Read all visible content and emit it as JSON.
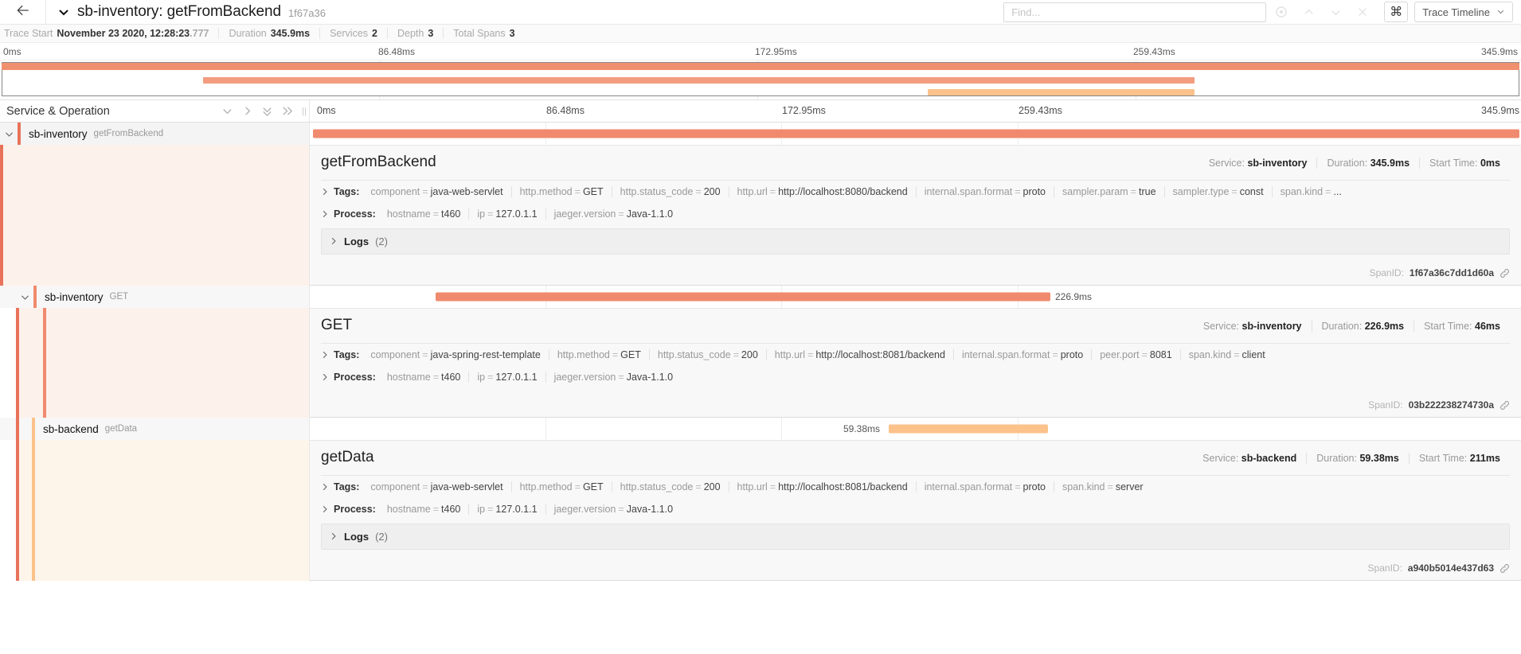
{
  "header": {
    "back_icon": "arrow-left-icon",
    "caret_icon": "chevron-down-icon",
    "trace_title": "sb-inventory: getFromBackend",
    "trace_id": "1f67a36",
    "find_placeholder": "Find...",
    "find_value": "",
    "nav_icons": [
      "crosshair-icon",
      "chevron-up-icon",
      "chevron-down-icon",
      "close-icon"
    ],
    "kbd_label": "⌘",
    "view_label": "Trace Timeline"
  },
  "meta": {
    "trace_start_label": "Trace Start",
    "trace_start_value": "November 23 2020, 12:28:23",
    "trace_start_frac": ".777",
    "duration_label": "Duration",
    "duration_value": "345.9ms",
    "services_label": "Services",
    "services_value": "2",
    "depth_label": "Depth",
    "depth_value": "3",
    "total_spans_label": "Total Spans",
    "total_spans_value": "3"
  },
  "minimap": {
    "ticks": [
      "0ms",
      "86.48ms",
      "172.95ms",
      "259.43ms",
      "345.9ms"
    ]
  },
  "columns": {
    "service_operation": "Service & Operation",
    "actions": [
      "chevron-down-icon",
      "chevron-right-icon",
      "double-chevron-down-icon",
      "double-chevron-right-icon"
    ],
    "grip_icon": "column-resize-grip-icon",
    "ticks": [
      "0ms",
      "86.48ms",
      "172.95ms",
      "259.43ms",
      "345.9ms"
    ]
  },
  "colors": {
    "accent_dark": "#e8735a",
    "accent_bar": "#f08a6e",
    "accent_light": "#fbc28b",
    "row_tint": "#fdf1ec",
    "row_tint_light": "#fdf5ea"
  },
  "spans": [
    {
      "service": "sb-inventory",
      "operation": "getFromBackend",
      "depth": 0,
      "expander_icon": "chevron-down-icon",
      "bar_label": "",
      "detail": {
        "operation": "getFromBackend",
        "service_label": "Service:",
        "service_value": "sb-inventory",
        "duration_label": "Duration:",
        "duration_value": "345.9ms",
        "start_label": "Start Time:",
        "start_value": "0ms",
        "tags_label": "Tags:",
        "tags": [
          {
            "k": "component",
            "v": "java-web-servlet"
          },
          {
            "k": "http.method",
            "v": "GET"
          },
          {
            "k": "http.status_code",
            "v": "200"
          },
          {
            "k": "http.url",
            "v": "http://localhost:8080/backend"
          },
          {
            "k": "internal.span.format",
            "v": "proto"
          },
          {
            "k": "sampler.param",
            "v": "true"
          },
          {
            "k": "sampler.type",
            "v": "const"
          },
          {
            "k": "span.kind",
            "v": "..."
          }
        ],
        "process_label": "Process:",
        "process": [
          {
            "k": "hostname",
            "v": "t460"
          },
          {
            "k": "ip",
            "v": "127.0.1.1"
          },
          {
            "k": "jaeger.version",
            "v": "Java-1.1.0"
          }
        ],
        "logs_label": "Logs",
        "logs_count": "(2)",
        "span_id_label": "SpanID:",
        "span_id_value": "1f67a36c7dd1d60a"
      }
    },
    {
      "service": "sb-inventory",
      "operation": "GET",
      "depth": 1,
      "expander_icon": "chevron-down-icon",
      "bar_label": "226.9ms",
      "detail": {
        "operation": "GET",
        "service_label": "Service:",
        "service_value": "sb-inventory",
        "duration_label": "Duration:",
        "duration_value": "226.9ms",
        "start_label": "Start Time:",
        "start_value": "46ms",
        "tags_label": "Tags:",
        "tags": [
          {
            "k": "component",
            "v": "java-spring-rest-template"
          },
          {
            "k": "http.method",
            "v": "GET"
          },
          {
            "k": "http.status_code",
            "v": "200"
          },
          {
            "k": "http.url",
            "v": "http://localhost:8081/backend"
          },
          {
            "k": "internal.span.format",
            "v": "proto"
          },
          {
            "k": "peer.port",
            "v": "8081"
          },
          {
            "k": "span.kind",
            "v": "client"
          }
        ],
        "process_label": "Process:",
        "process": [
          {
            "k": "hostname",
            "v": "t460"
          },
          {
            "k": "ip",
            "v": "127.0.1.1"
          },
          {
            "k": "jaeger.version",
            "v": "Java-1.1.0"
          }
        ],
        "logs_label": "",
        "logs_count": "",
        "span_id_label": "SpanID:",
        "span_id_value": "03b222238274730a"
      }
    },
    {
      "service": "sb-backend",
      "operation": "getData",
      "depth": 2,
      "expander_icon": "",
      "bar_label": "59.38ms",
      "detail": {
        "operation": "getData",
        "service_label": "Service:",
        "service_value": "sb-backend",
        "duration_label": "Duration:",
        "duration_value": "59.38ms",
        "start_label": "Start Time:",
        "start_value": "211ms",
        "tags_label": "Tags:",
        "tags": [
          {
            "k": "component",
            "v": "java-web-servlet"
          },
          {
            "k": "http.method",
            "v": "GET"
          },
          {
            "k": "http.status_code",
            "v": "200"
          },
          {
            "k": "http.url",
            "v": "http://localhost:8081/backend"
          },
          {
            "k": "internal.span.format",
            "v": "proto"
          },
          {
            "k": "span.kind",
            "v": "server"
          }
        ],
        "process_label": "Process:",
        "process": [
          {
            "k": "hostname",
            "v": "t460"
          },
          {
            "k": "ip",
            "v": "127.0.1.1"
          },
          {
            "k": "jaeger.version",
            "v": "Java-1.1.0"
          }
        ],
        "logs_label": "Logs",
        "logs_count": "(2)",
        "span_id_label": "SpanID:",
        "span_id_value": "a940b5014e437d63"
      }
    }
  ]
}
